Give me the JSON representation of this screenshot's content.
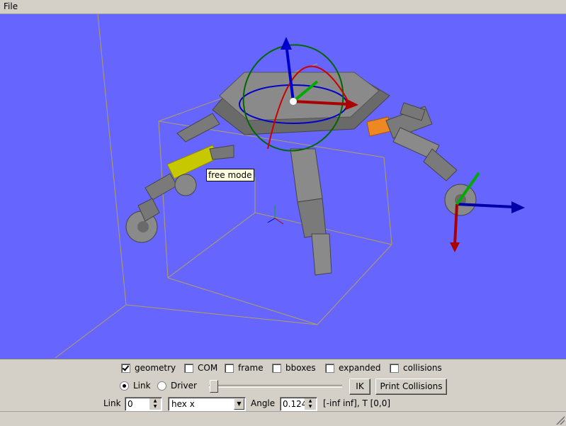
{
  "menubar": {
    "file": "File"
  },
  "viewport": {
    "tooltip": "free mode",
    "background": "#6666ff"
  },
  "display_options": [
    {
      "label": "geometry",
      "checked": true
    },
    {
      "label": "COM",
      "checked": false
    },
    {
      "label": "frame",
      "checked": false
    },
    {
      "label": "bboxes",
      "checked": false
    },
    {
      "label": "expanded",
      "checked": false
    },
    {
      "label": "collisions",
      "checked": false
    }
  ],
  "mode": {
    "link_label": "Link",
    "driver_label": "Driver",
    "selected": "Link"
  },
  "slider": {
    "value_fraction": 0.0
  },
  "buttons": {
    "ik": "IK",
    "print_collisions": "Print Collisions"
  },
  "link_row": {
    "link_label": "Link",
    "link_value": "0",
    "dof_value": "hex x",
    "angle_label": "Angle",
    "angle_value": "0.124",
    "range_text": "[-inf inf], T [0,0]"
  }
}
